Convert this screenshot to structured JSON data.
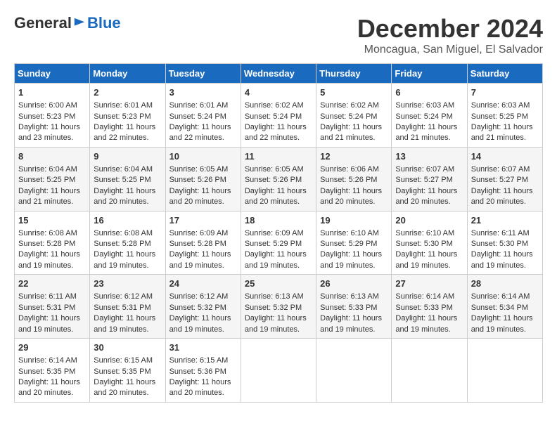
{
  "logo": {
    "general": "General",
    "blue": "Blue"
  },
  "title": "December 2024",
  "location": "Moncagua, San Miguel, El Salvador",
  "weekdays": [
    "Sunday",
    "Monday",
    "Tuesday",
    "Wednesday",
    "Thursday",
    "Friday",
    "Saturday"
  ],
  "weeks": [
    [
      {
        "day": "1",
        "sunrise": "6:00 AM",
        "sunset": "5:23 PM",
        "daylight": "11 hours and 23 minutes."
      },
      {
        "day": "2",
        "sunrise": "6:01 AM",
        "sunset": "5:23 PM",
        "daylight": "11 hours and 22 minutes."
      },
      {
        "day": "3",
        "sunrise": "6:01 AM",
        "sunset": "5:24 PM",
        "daylight": "11 hours and 22 minutes."
      },
      {
        "day": "4",
        "sunrise": "6:02 AM",
        "sunset": "5:24 PM",
        "daylight": "11 hours and 22 minutes."
      },
      {
        "day": "5",
        "sunrise": "6:02 AM",
        "sunset": "5:24 PM",
        "daylight": "11 hours and 21 minutes."
      },
      {
        "day": "6",
        "sunrise": "6:03 AM",
        "sunset": "5:24 PM",
        "daylight": "11 hours and 21 minutes."
      },
      {
        "day": "7",
        "sunrise": "6:03 AM",
        "sunset": "5:25 PM",
        "daylight": "11 hours and 21 minutes."
      }
    ],
    [
      {
        "day": "8",
        "sunrise": "6:04 AM",
        "sunset": "5:25 PM",
        "daylight": "11 hours and 21 minutes."
      },
      {
        "day": "9",
        "sunrise": "6:04 AM",
        "sunset": "5:25 PM",
        "daylight": "11 hours and 20 minutes."
      },
      {
        "day": "10",
        "sunrise": "6:05 AM",
        "sunset": "5:26 PM",
        "daylight": "11 hours and 20 minutes."
      },
      {
        "day": "11",
        "sunrise": "6:05 AM",
        "sunset": "5:26 PM",
        "daylight": "11 hours and 20 minutes."
      },
      {
        "day": "12",
        "sunrise": "6:06 AM",
        "sunset": "5:26 PM",
        "daylight": "11 hours and 20 minutes."
      },
      {
        "day": "13",
        "sunrise": "6:07 AM",
        "sunset": "5:27 PM",
        "daylight": "11 hours and 20 minutes."
      },
      {
        "day": "14",
        "sunrise": "6:07 AM",
        "sunset": "5:27 PM",
        "daylight": "11 hours and 20 minutes."
      }
    ],
    [
      {
        "day": "15",
        "sunrise": "6:08 AM",
        "sunset": "5:28 PM",
        "daylight": "11 hours and 19 minutes."
      },
      {
        "day": "16",
        "sunrise": "6:08 AM",
        "sunset": "5:28 PM",
        "daylight": "11 hours and 19 minutes."
      },
      {
        "day": "17",
        "sunrise": "6:09 AM",
        "sunset": "5:28 PM",
        "daylight": "11 hours and 19 minutes."
      },
      {
        "day": "18",
        "sunrise": "6:09 AM",
        "sunset": "5:29 PM",
        "daylight": "11 hours and 19 minutes."
      },
      {
        "day": "19",
        "sunrise": "6:10 AM",
        "sunset": "5:29 PM",
        "daylight": "11 hours and 19 minutes."
      },
      {
        "day": "20",
        "sunrise": "6:10 AM",
        "sunset": "5:30 PM",
        "daylight": "11 hours and 19 minutes."
      },
      {
        "day": "21",
        "sunrise": "6:11 AM",
        "sunset": "5:30 PM",
        "daylight": "11 hours and 19 minutes."
      }
    ],
    [
      {
        "day": "22",
        "sunrise": "6:11 AM",
        "sunset": "5:31 PM",
        "daylight": "11 hours and 19 minutes."
      },
      {
        "day": "23",
        "sunrise": "6:12 AM",
        "sunset": "5:31 PM",
        "daylight": "11 hours and 19 minutes."
      },
      {
        "day": "24",
        "sunrise": "6:12 AM",
        "sunset": "5:32 PM",
        "daylight": "11 hours and 19 minutes."
      },
      {
        "day": "25",
        "sunrise": "6:13 AM",
        "sunset": "5:32 PM",
        "daylight": "11 hours and 19 minutes."
      },
      {
        "day": "26",
        "sunrise": "6:13 AM",
        "sunset": "5:33 PM",
        "daylight": "11 hours and 19 minutes."
      },
      {
        "day": "27",
        "sunrise": "6:14 AM",
        "sunset": "5:33 PM",
        "daylight": "11 hours and 19 minutes."
      },
      {
        "day": "28",
        "sunrise": "6:14 AM",
        "sunset": "5:34 PM",
        "daylight": "11 hours and 19 minutes."
      }
    ],
    [
      {
        "day": "29",
        "sunrise": "6:14 AM",
        "sunset": "5:35 PM",
        "daylight": "11 hours and 20 minutes."
      },
      {
        "day": "30",
        "sunrise": "6:15 AM",
        "sunset": "5:35 PM",
        "daylight": "11 hours and 20 minutes."
      },
      {
        "day": "31",
        "sunrise": "6:15 AM",
        "sunset": "5:36 PM",
        "daylight": "11 hours and 20 minutes."
      },
      null,
      null,
      null,
      null
    ]
  ]
}
